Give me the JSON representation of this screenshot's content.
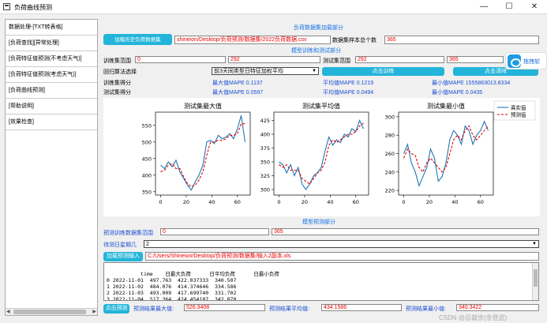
{
  "window": {
    "title": "负荷曲线预测",
    "min": "—",
    "max": "☐",
    "close": "✕"
  },
  "tabs": [
    {
      "label": "数据处理-[TXT转表格]"
    },
    {
      "label": "[负荷查找][异常处理]"
    },
    {
      "label": "[负荷特征值预测(不考虑天气)]"
    },
    {
      "label": "[负荷特征值预测(考虑天气)]"
    },
    {
      "label": "[负荷曲线预测]"
    },
    {
      "label": "[帮助说明]"
    },
    {
      "label": "[效果检查]"
    }
  ],
  "load_section": {
    "title": "负荷数据集加载部分",
    "load_button": "加载历史负荷数据集",
    "path": "shineion/Desktop/负荷预测/数据集/2022负荷数据.csv",
    "count_label": "数据集样本总个数",
    "count_value": "365"
  },
  "model_section": {
    "title": "模型训练和测试部分",
    "train_range_label": "训练集范围",
    "train_start": "0",
    "train_end": "292",
    "test_range_label": "测试集范围",
    "test_start": "292",
    "test_end": "365",
    "algo_label": "回归算法选择",
    "algo_value": "前3天同类型日特征加权平均",
    "train_button": "点击训练",
    "clear_button": "点击清除",
    "train_score_label": "训练集得分",
    "test_score_label": "测试集得分",
    "train_max": "最大值MAPE 0.1137",
    "train_avg": "平均值MAPE 0.1219",
    "train_min": "最小值MAPE 1555863013.8334",
    "test_max": "最大值MAPE 0.0597",
    "test_avg": "平均值MAPE 0.0494",
    "test_min": "最小值MAPE 0.0435"
  },
  "chart_data": [
    {
      "type": "line",
      "title": "测试集最大值",
      "x": [
        0,
        3,
        6,
        9,
        12,
        15,
        18,
        21,
        24,
        27,
        30,
        33,
        36,
        39,
        42,
        45,
        48,
        51,
        54,
        57,
        60,
        63,
        66
      ],
      "series": [
        {
          "name": "真实值",
          "values": [
            430,
            420,
            440,
            425,
            445,
            410,
            390,
            370,
            355,
            380,
            400,
            430,
            500,
            505,
            495,
            520,
            510,
            515,
            525,
            510,
            540,
            580,
            500
          ]
        },
        {
          "name": "预测值",
          "values": [
            410,
            415,
            430,
            435,
            420,
            420,
            395,
            375,
            365,
            370,
            385,
            410,
            460,
            500,
            500,
            505,
            505,
            510,
            520,
            520,
            525,
            555,
            555
          ]
        }
      ],
      "ylim": [
        340,
        590
      ],
      "yticks": [
        350,
        400,
        450,
        500,
        550
      ],
      "xticks": [
        0,
        20,
        40,
        60
      ]
    },
    {
      "type": "line",
      "title": "测试集平均值",
      "x": [
        0,
        3,
        6,
        9,
        12,
        15,
        18,
        21,
        24,
        27,
        30,
        33,
        36,
        39,
        42,
        45,
        48,
        51,
        54,
        57,
        60,
        63,
        66
      ],
      "series": [
        {
          "name": "真实值",
          "values": [
            350,
            345,
            330,
            345,
            325,
            340,
            310,
            300,
            310,
            325,
            330,
            340,
            370,
            395,
            380,
            390,
            385,
            400,
            395,
            410,
            405,
            425,
            410
          ]
        },
        {
          "name": "预测值",
          "values": [
            345,
            340,
            345,
            335,
            335,
            335,
            320,
            315,
            310,
            320,
            330,
            335,
            350,
            380,
            390,
            385,
            390,
            395,
            400,
            400,
            405,
            415,
            420
          ]
        }
      ],
      "ylim": [
        290,
        440
      ],
      "yticks": [
        300,
        325,
        350,
        375,
        400,
        425
      ],
      "xticks": [
        0,
        20,
        40,
        60
      ]
    },
    {
      "type": "line",
      "title": "测试集最小值",
      "x": [
        0,
        3,
        6,
        9,
        12,
        15,
        18,
        21,
        24,
        27,
        30,
        33,
        36,
        39,
        42,
        45,
        48,
        51,
        54,
        57,
        60,
        63,
        66
      ],
      "series": [
        {
          "name": "真实值",
          "values": [
            260,
            270,
            250,
            240,
            225,
            235,
            245,
            265,
            255,
            230,
            235,
            250,
            275,
            285,
            280,
            270,
            290,
            285,
            270,
            280,
            285,
            295,
            285
          ]
        },
        {
          "name": "预测值",
          "values": [
            255,
            265,
            260,
            258,
            245,
            240,
            250,
            255,
            250,
            245,
            240,
            245,
            260,
            275,
            280,
            275,
            285,
            290,
            280,
            275,
            280,
            285,
            290
          ]
        }
      ],
      "ylim": [
        215,
        305
      ],
      "yticks": [
        220,
        240,
        260,
        280,
        300
      ],
      "xticks": [
        0,
        20,
        40,
        60
      ]
    }
  ],
  "legend": {
    "real": "真实值",
    "pred": "预测值"
  },
  "colors": {
    "real": "#1f77b4",
    "pred": "#e00000",
    "accent": "#23b4d9"
  },
  "predict_section": {
    "title": "模型预测部分",
    "range_label": "预测训练数据集范围",
    "range_start": "0",
    "range_end": "365",
    "period_label": "待测日星期几",
    "period_value": "2",
    "load_input_button": "加载预测输入",
    "input_path": "C:/Users/Shineion/Desktop/负荷预测/数据集/输入2副本.xls",
    "table_text": "       time    日最大负荷      日平均负荷      日最小负荷\n0 2022-11-01  497.763  422.037333  340.507\n1 2022-11-02  484.076  414.374646  334.586\n2 2022-11-03  493.009  417.699740  331.702\n3 2022-11-04  517.364  424.454187  342.870",
    "predict_button": "点击预测",
    "res_max_label": "预测结果最大值:",
    "res_max": "526.3408",
    "res_avg_label": "预测结果平均值:",
    "res_avg": "434.1586",
    "res_min_label": "预测结果最小值:",
    "res_min": "340.3422"
  },
  "float_widget": {
    "label": "拖拽软"
  },
  "watermark": "CSDN @忌栽余(余登武)"
}
